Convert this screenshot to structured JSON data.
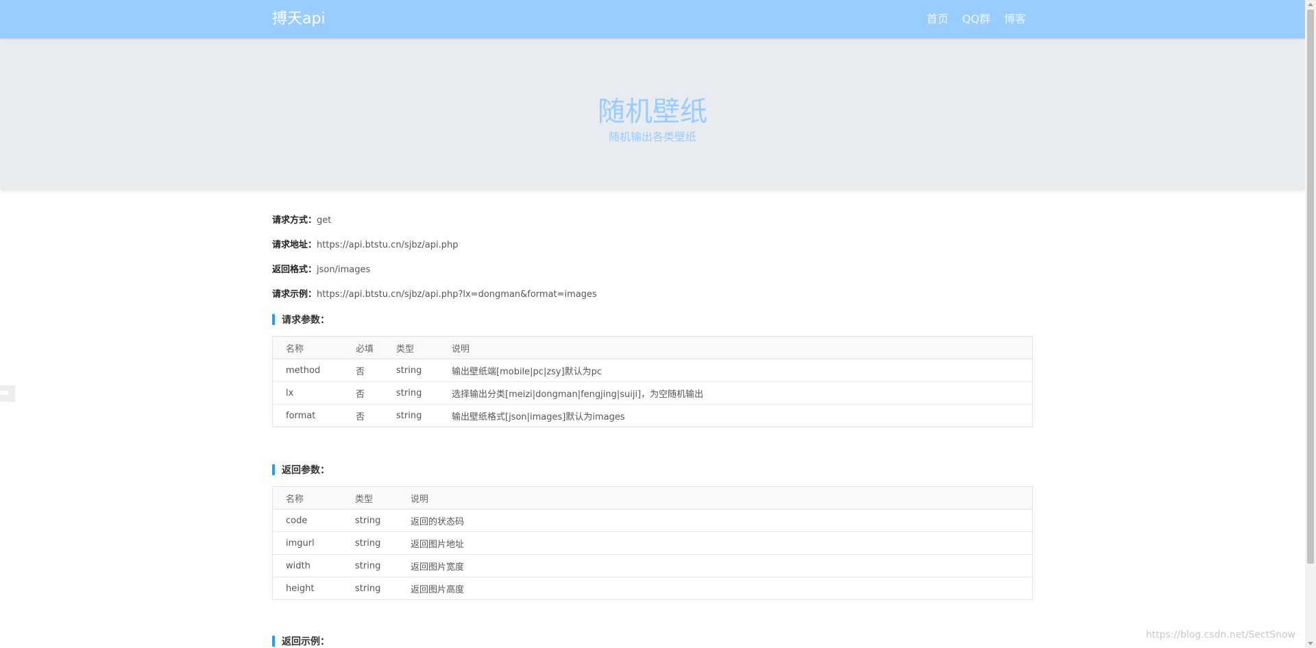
{
  "navbar": {
    "brand": "搏天api",
    "links": [
      "首页",
      "QQ群",
      "博客"
    ]
  },
  "hero": {
    "title": "随机壁纸",
    "subtitle": "随机输出各类壁纸"
  },
  "info": [
    {
      "label": "请求方式：",
      "value": "get"
    },
    {
      "label": "请求地址：",
      "value": "https://api.btstu.cn/sjbz/api.php"
    },
    {
      "label": "返回格式：",
      "value": "json/images"
    },
    {
      "label": "请求示例：",
      "value": "https://api.btstu.cn/sjbz/api.php?lx=dongman&format=images"
    }
  ],
  "request_params": {
    "heading": "请求参数：",
    "headers": [
      "名称",
      "必填",
      "类型",
      "说明"
    ],
    "rows": [
      [
        "method",
        "否",
        "string",
        "输出壁纸端[mobile|pc|zsy]默认为pc"
      ],
      [
        "lx",
        "否",
        "string",
        "选择输出分类[meizi|dongman|fengjing|suiji]，为空随机输出"
      ],
      [
        "format",
        "否",
        "string",
        "输出壁纸格式[json|images]默认为images"
      ]
    ]
  },
  "response_params": {
    "heading": "返回参数：",
    "headers": [
      "名称",
      "类型",
      "说明"
    ],
    "rows": [
      [
        "code",
        "string",
        "返回的状态码"
      ],
      [
        "imgurl",
        "string",
        "返回图片地址"
      ],
      [
        "width",
        "string",
        "返回图片宽度"
      ],
      [
        "height",
        "string",
        "返回图片高度"
      ]
    ]
  },
  "response_example": {
    "heading": "返回示例："
  },
  "watermark": "https://blog.csdn.net/SectSnow",
  "colors": {
    "navbar": "#99ccff",
    "hero_bg": "#e8ecf0",
    "hero_text": "#99ccff",
    "accent_bar": "#1e9fff"
  }
}
